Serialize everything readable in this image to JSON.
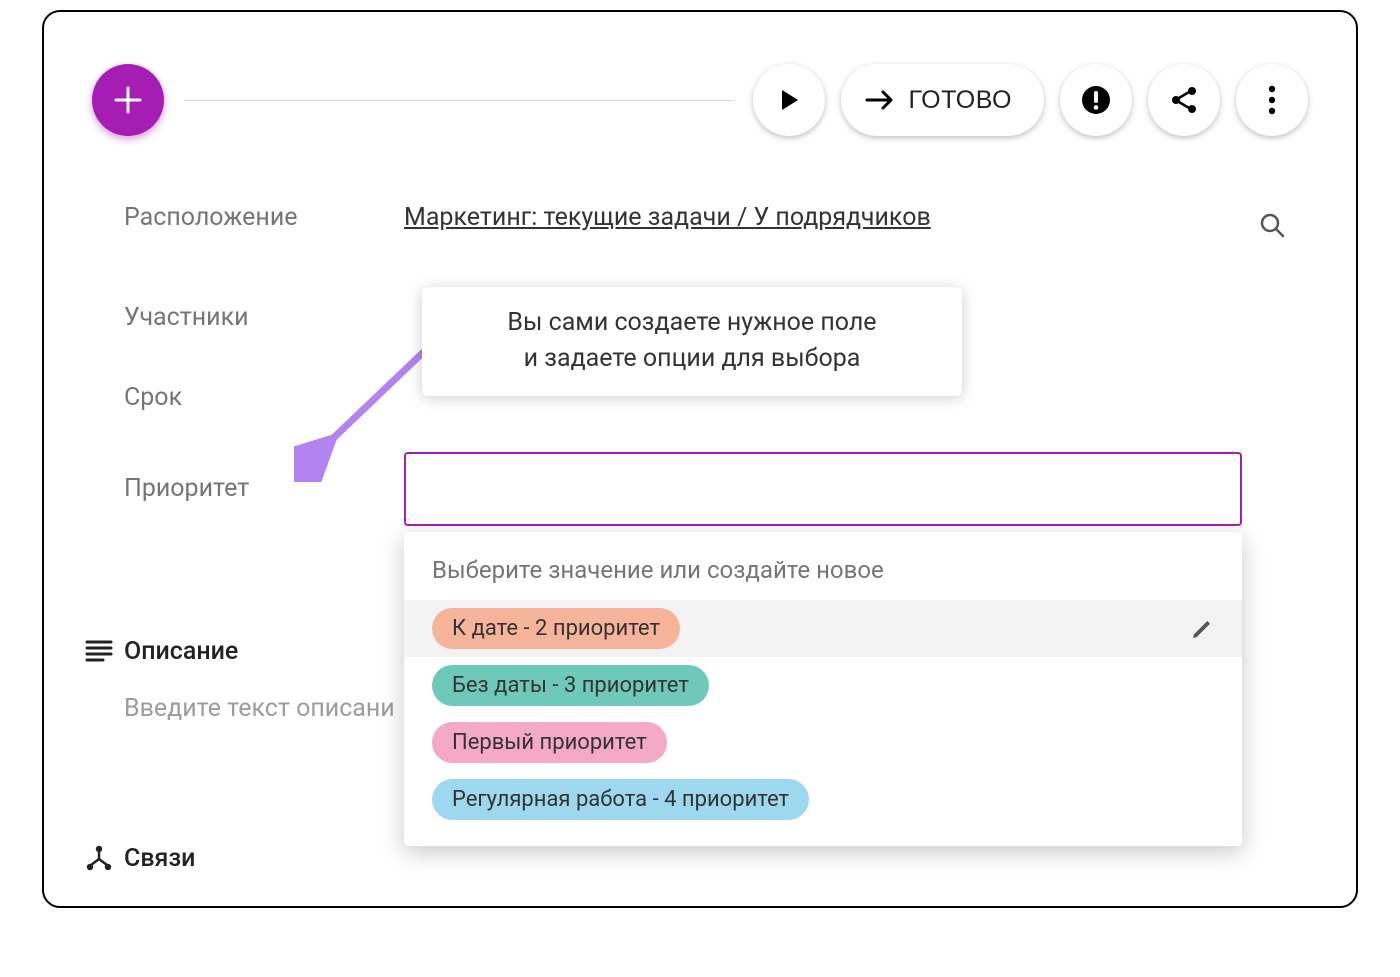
{
  "toolbar": {
    "done_label": "ГОТОВО"
  },
  "fields": {
    "location_label": "Расположение",
    "location_value": "Маркетинг: текущие задачи / У подрядчиков",
    "participants_label": "Участники",
    "deadline_label": "Срок",
    "priority_label": "Приоритет",
    "description_label": "Описание",
    "description_placeholder": "Введите текст описани",
    "relations_label": "Связи"
  },
  "tooltip": {
    "line1": "Вы сами создаете нужное поле",
    "line2": "и задаете опции для выбора"
  },
  "dropdown": {
    "header": "Выберите значение или создайте новое",
    "options": [
      {
        "label": "К дате - 2 приоритет",
        "color": "#f6b49a"
      },
      {
        "label": "Без даты - 3 приоритет",
        "color": "#6fc9bb"
      },
      {
        "label": "Первый приоритет",
        "color": "#f4a9c7"
      },
      {
        "label": "Регулярная работа - 4 приоритет",
        "color": "#9dd8ee"
      }
    ]
  }
}
